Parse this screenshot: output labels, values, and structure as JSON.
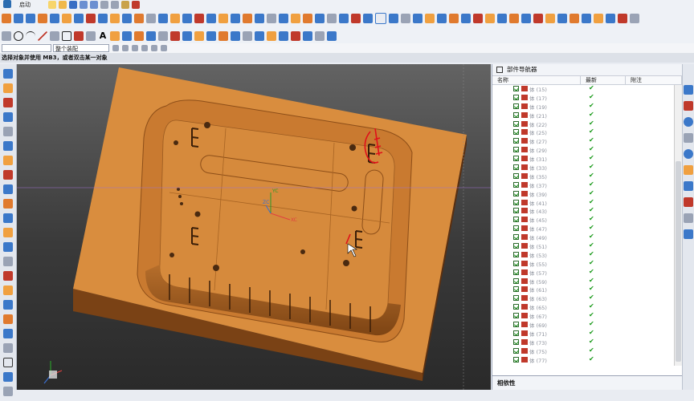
{
  "menu": {
    "start_label": "启动"
  },
  "filter_dropdown": {
    "value": ""
  },
  "assembly_dropdown": {
    "value": "整个装配"
  },
  "status": {
    "prompt": "选择对象并使用 MB3，或者双击某一对象"
  },
  "navigator": {
    "title": "部件导航器",
    "columns": {
      "name": "名称",
      "latest": "最新",
      "note": "附注"
    },
    "rows": [
      {
        "label": "体 (15)"
      },
      {
        "label": "体 (17)"
      },
      {
        "label": "体 (19)"
      },
      {
        "label": "体 (21)"
      },
      {
        "label": "体 (22)"
      },
      {
        "label": "体 (25)"
      },
      {
        "label": "体 (27)"
      },
      {
        "label": "体 (29)"
      },
      {
        "label": "体 (31)"
      },
      {
        "label": "体 (33)"
      },
      {
        "label": "体 (35)"
      },
      {
        "label": "体 (37)"
      },
      {
        "label": "体 (39)"
      },
      {
        "label": "体 (41)"
      },
      {
        "label": "体 (43)"
      },
      {
        "label": "体 (45)"
      },
      {
        "label": "体 (47)"
      },
      {
        "label": "体 (49)"
      },
      {
        "label": "体 (51)"
      },
      {
        "label": "体 (53)"
      },
      {
        "label": "体 (55)"
      },
      {
        "label": "体 (57)"
      },
      {
        "label": "体 (59)"
      },
      {
        "label": "体 (61)"
      },
      {
        "label": "体 (63)"
      },
      {
        "label": "体 (65)"
      },
      {
        "label": "体 (67)"
      },
      {
        "label": "体 (69)"
      },
      {
        "label": "体 (71)"
      },
      {
        "label": "体 (73)"
      },
      {
        "label": "体 (75)"
      },
      {
        "label": "体 (77)"
      }
    ],
    "dependencies_label": "相依性"
  },
  "viewport": {
    "axis_labels": {
      "x": "XC",
      "y": "YC",
      "z": "ZC"
    },
    "colors": {
      "mold": "#d98d3e",
      "mold_dark": "#a85f22",
      "background": "#4a4a4a",
      "markup": "#e0101a"
    }
  }
}
